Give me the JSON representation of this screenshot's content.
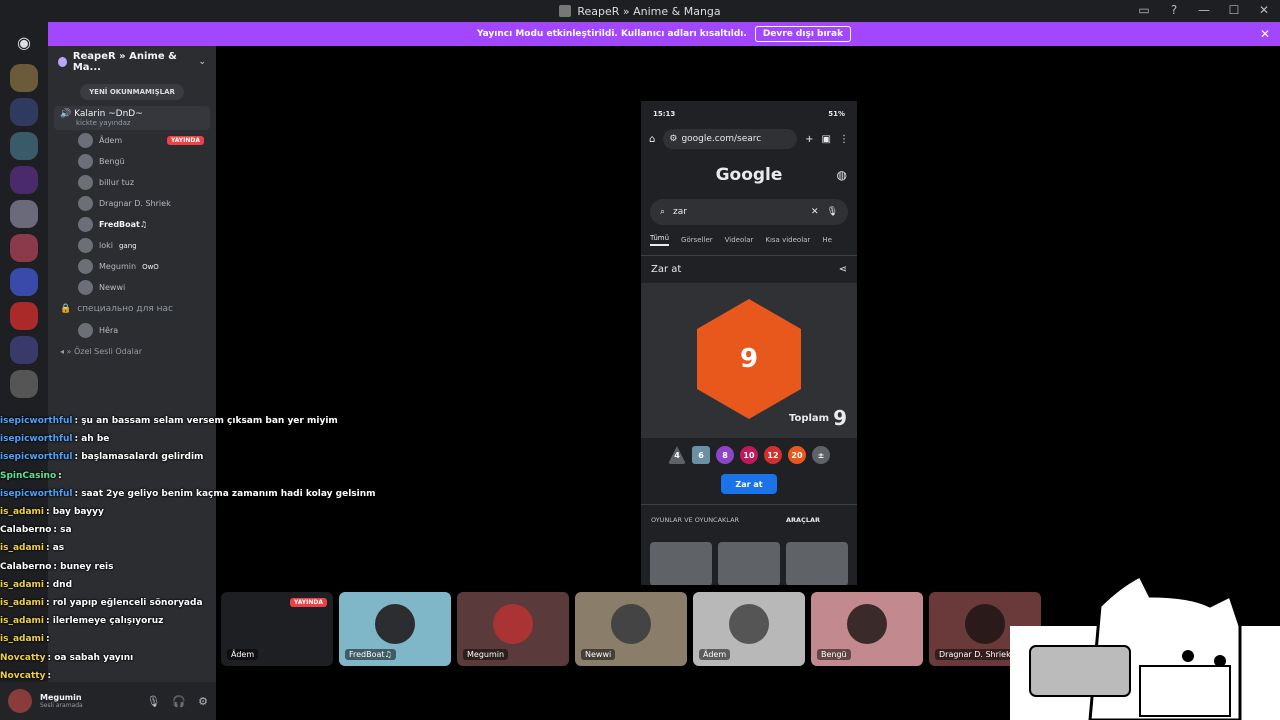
{
  "window": {
    "title": "ReapeR » Anime & Manga"
  },
  "banner": {
    "text": "Yayıncı Modu etkinleştirildi. Kullanıcı adları kısaltıldı.",
    "button": "Devre dışı bırak"
  },
  "server": {
    "name": "ReapeR » Anime & Ma..."
  },
  "unread_pill": "YENİ OKUNMAMIŞLAR",
  "voice_channel": {
    "name": "Kalarin ~DnD~",
    "sub": "kickte yayındaz"
  },
  "members": [
    {
      "name": "Âdem",
      "live": "YAYINDA"
    },
    {
      "name": "Bengü"
    },
    {
      "name": "billur tuz"
    },
    {
      "name": "Dragnar D. Shriek"
    },
    {
      "name": "FredBoat♫"
    },
    {
      "name": "loki",
      "extra": "gang"
    },
    {
      "name": "Megumin",
      "extra": "OwO"
    },
    {
      "name": "Newwi"
    }
  ],
  "channel2": "специально для нас",
  "channel2_member": "Hêra",
  "category": "Özel Sesli Odalar",
  "chat": [
    {
      "user": "isepicworthful",
      "color": "blue",
      "msg": ": şu an bassam selam versem çıksam ban yer miyim"
    },
    {
      "user": "isepicworthful",
      "color": "blue",
      "msg": ": ah be"
    },
    {
      "user": "isepicworthful",
      "color": "blue",
      "msg": ": başlamasalardı gelirdim"
    },
    {
      "user": "SpinCasino",
      "color": "green",
      "msg": ":"
    },
    {
      "user": "isepicworthful",
      "color": "blue",
      "msg": ": saat 2ye geliyo benim kaçma zamanım hadi kolay gelsinm"
    },
    {
      "user": "is_adami",
      "color": "yellow",
      "msg": ": bay bayyy"
    },
    {
      "user": "Calaberno",
      "color": "white",
      "msg": ": sa"
    },
    {
      "user": "is_adami",
      "color": "yellow",
      "msg": ": as"
    },
    {
      "user": "Calaberno",
      "color": "white",
      "msg": ": buney reis"
    },
    {
      "user": "is_adami",
      "color": "yellow",
      "msg": ": dnd"
    },
    {
      "user": "is_adami",
      "color": "yellow",
      "msg": ": rol yapıp eğlenceli sönoryada"
    },
    {
      "user": "is_adami",
      "color": "yellow",
      "msg": ": ilerlemeye çalışıyoruz"
    },
    {
      "user": "is_adami",
      "color": "yellow",
      "msg": ":"
    },
    {
      "user": "Novcatty",
      "color": "yellow",
      "msg": ": oa sabah yayını"
    },
    {
      "user": "Novcatty",
      "color": "yellow",
      "msg": ":"
    }
  ],
  "user": {
    "name": "Megumin",
    "status": "Sesli aramada"
  },
  "phone": {
    "time": "15:13",
    "battery": "51%",
    "url": "google.com/searc",
    "logo": "Google",
    "query": "zar",
    "tabs": [
      "Tümü",
      "Görseller",
      "Videolar",
      "Kısa videolar",
      "He"
    ],
    "card_title": "Zar at",
    "die_value": "9",
    "total_label": "Toplam",
    "total_value": "9",
    "dice": [
      "4",
      "6",
      "8",
      "10",
      "12",
      "20",
      "±"
    ],
    "roll_button": "Zar at",
    "bottom_tabs": [
      "OYUNLAR VE OYUNCAKLAR",
      "ARAÇLAR"
    ]
  },
  "tiles": [
    {
      "name": "Âdem",
      "live": "YAYINDA",
      "color": "#1e1f22"
    },
    {
      "name": "FredBoat♫",
      "color": "#7fb7c9"
    },
    {
      "name": "Megumin",
      "color": "#5a3a3a"
    },
    {
      "name": "Newwi",
      "color": "#8a7d6a"
    },
    {
      "name": "Âdem",
      "color": "#b8b8b8"
    },
    {
      "name": "Bengü",
      "color": "#c28a8e"
    },
    {
      "name": "Dragnar D. Shriek",
      "color": "#6a3a3a"
    }
  ],
  "colors": {
    "accent": "#a347ff",
    "live": "#ed4245",
    "die": "#e8581c",
    "roll": "#1a73e8"
  }
}
